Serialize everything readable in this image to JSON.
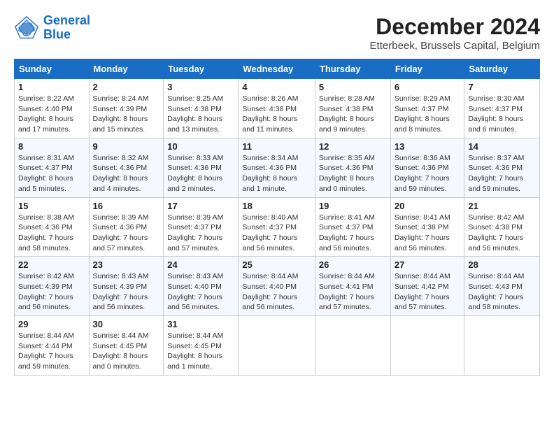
{
  "logo": {
    "line1": "General",
    "line2": "Blue"
  },
  "title": "December 2024",
  "location": "Etterbeek, Brussels Capital, Belgium",
  "days_header": [
    "Sunday",
    "Monday",
    "Tuesday",
    "Wednesday",
    "Thursday",
    "Friday",
    "Saturday"
  ],
  "weeks": [
    [
      {
        "day": "1",
        "info": "Sunrise: 8:22 AM\nSunset: 4:40 PM\nDaylight: 8 hours and 17 minutes."
      },
      {
        "day": "2",
        "info": "Sunrise: 8:24 AM\nSunset: 4:39 PM\nDaylight: 8 hours and 15 minutes."
      },
      {
        "day": "3",
        "info": "Sunrise: 8:25 AM\nSunset: 4:38 PM\nDaylight: 8 hours and 13 minutes."
      },
      {
        "day": "4",
        "info": "Sunrise: 8:26 AM\nSunset: 4:38 PM\nDaylight: 8 hours and 11 minutes."
      },
      {
        "day": "5",
        "info": "Sunrise: 8:28 AM\nSunset: 4:38 PM\nDaylight: 8 hours and 9 minutes."
      },
      {
        "day": "6",
        "info": "Sunrise: 8:29 AM\nSunset: 4:37 PM\nDaylight: 8 hours and 8 minutes."
      },
      {
        "day": "7",
        "info": "Sunrise: 8:30 AM\nSunset: 4:37 PM\nDaylight: 8 hours and 6 minutes."
      }
    ],
    [
      {
        "day": "8",
        "info": "Sunrise: 8:31 AM\nSunset: 4:37 PM\nDaylight: 8 hours and 5 minutes."
      },
      {
        "day": "9",
        "info": "Sunrise: 8:32 AM\nSunset: 4:36 PM\nDaylight: 8 hours and 4 minutes."
      },
      {
        "day": "10",
        "info": "Sunrise: 8:33 AM\nSunset: 4:36 PM\nDaylight: 8 hours and 2 minutes."
      },
      {
        "day": "11",
        "info": "Sunrise: 8:34 AM\nSunset: 4:36 PM\nDaylight: 8 hours and 1 minute."
      },
      {
        "day": "12",
        "info": "Sunrise: 8:35 AM\nSunset: 4:36 PM\nDaylight: 8 hours and 0 minutes."
      },
      {
        "day": "13",
        "info": "Sunrise: 8:36 AM\nSunset: 4:36 PM\nDaylight: 7 hours and 59 minutes."
      },
      {
        "day": "14",
        "info": "Sunrise: 8:37 AM\nSunset: 4:36 PM\nDaylight: 7 hours and 59 minutes."
      }
    ],
    [
      {
        "day": "15",
        "info": "Sunrise: 8:38 AM\nSunset: 4:36 PM\nDaylight: 7 hours and 58 minutes."
      },
      {
        "day": "16",
        "info": "Sunrise: 8:39 AM\nSunset: 4:36 PM\nDaylight: 7 hours and 57 minutes."
      },
      {
        "day": "17",
        "info": "Sunrise: 8:39 AM\nSunset: 4:37 PM\nDaylight: 7 hours and 57 minutes."
      },
      {
        "day": "18",
        "info": "Sunrise: 8:40 AM\nSunset: 4:37 PM\nDaylight: 7 hours and 56 minutes."
      },
      {
        "day": "19",
        "info": "Sunrise: 8:41 AM\nSunset: 4:37 PM\nDaylight: 7 hours and 56 minutes."
      },
      {
        "day": "20",
        "info": "Sunrise: 8:41 AM\nSunset: 4:38 PM\nDaylight: 7 hours and 56 minutes."
      },
      {
        "day": "21",
        "info": "Sunrise: 8:42 AM\nSunset: 4:38 PM\nDaylight: 7 hours and 56 minutes."
      }
    ],
    [
      {
        "day": "22",
        "info": "Sunrise: 8:42 AM\nSunset: 4:39 PM\nDaylight: 7 hours and 56 minutes."
      },
      {
        "day": "23",
        "info": "Sunrise: 8:43 AM\nSunset: 4:39 PM\nDaylight: 7 hours and 56 minutes."
      },
      {
        "day": "24",
        "info": "Sunrise: 8:43 AM\nSunset: 4:40 PM\nDaylight: 7 hours and 56 minutes."
      },
      {
        "day": "25",
        "info": "Sunrise: 8:44 AM\nSunset: 4:40 PM\nDaylight: 7 hours and 56 minutes."
      },
      {
        "day": "26",
        "info": "Sunrise: 8:44 AM\nSunset: 4:41 PM\nDaylight: 7 hours and 57 minutes."
      },
      {
        "day": "27",
        "info": "Sunrise: 8:44 AM\nSunset: 4:42 PM\nDaylight: 7 hours and 57 minutes."
      },
      {
        "day": "28",
        "info": "Sunrise: 8:44 AM\nSunset: 4:43 PM\nDaylight: 7 hours and 58 minutes."
      }
    ],
    [
      {
        "day": "29",
        "info": "Sunrise: 8:44 AM\nSunset: 4:44 PM\nDaylight: 7 hours and 59 minutes."
      },
      {
        "day": "30",
        "info": "Sunrise: 8:44 AM\nSunset: 4:45 PM\nDaylight: 8 hours and 0 minutes."
      },
      {
        "day": "31",
        "info": "Sunrise: 8:44 AM\nSunset: 4:45 PM\nDaylight: 8 hours and 1 minute."
      },
      null,
      null,
      null,
      null
    ]
  ]
}
